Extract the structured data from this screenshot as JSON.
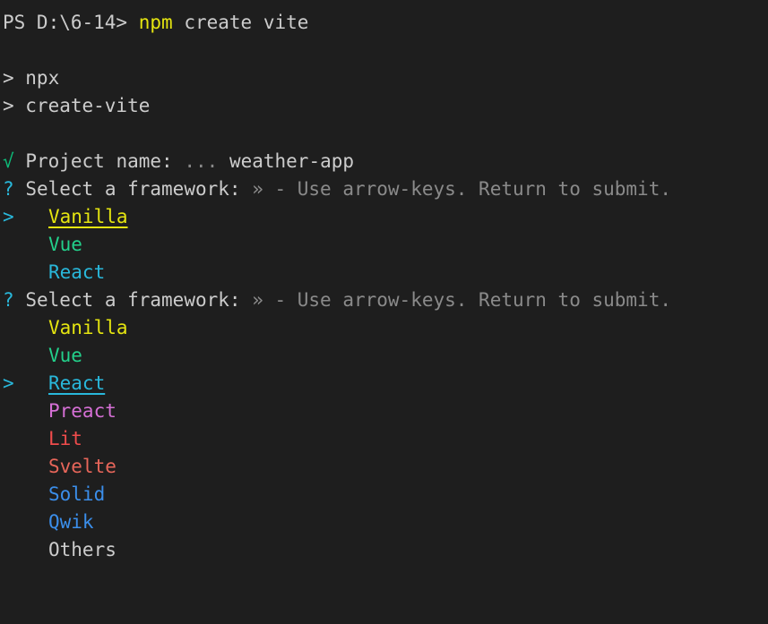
{
  "colors": {
    "default": "#cccccc",
    "yellow": "#e5e510",
    "green": "#23d18b",
    "cyan": "#29b8db",
    "magenta": "#d670d6",
    "red": "#f14c4c",
    "svelte": "#e8665a",
    "blue": "#3b8eea",
    "gray": "#8a8a8a",
    "check": "#0dbc79"
  },
  "prompt": {
    "ps": "PS D:\\6-14>",
    "cmd": "npm",
    "args": "create vite"
  },
  "npx": {
    "line1": "> npx",
    "line2": "> create-vite"
  },
  "project": {
    "check": "√",
    "label": "Project name:",
    "dots": "...",
    "value": "weather-app"
  },
  "select_prompt": {
    "q": "?",
    "label": "Select a framework:",
    "hint": "» - Use arrow-keys. Return to submit."
  },
  "pointer": ">",
  "menu1": [
    "Vanilla",
    "Vue",
    "React"
  ],
  "menu2": [
    "Vanilla",
    "Vue",
    "React",
    "Preact",
    "Lit",
    "Svelte",
    "Solid",
    "Qwik",
    "Others"
  ]
}
